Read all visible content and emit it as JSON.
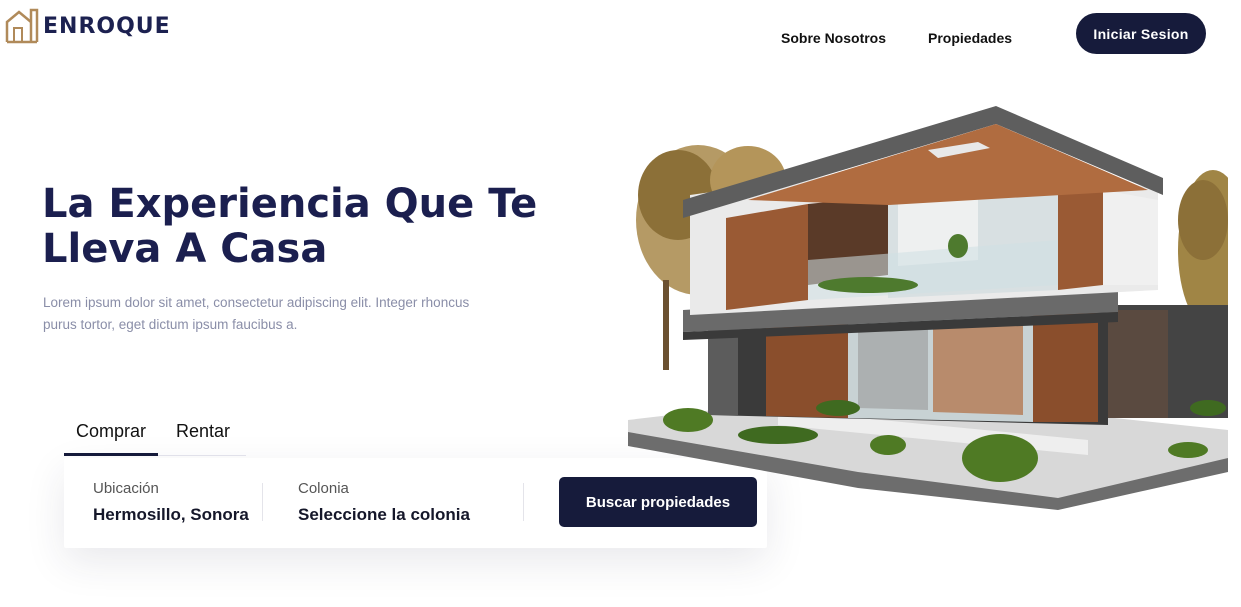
{
  "header": {
    "brand": "ENROQUE",
    "logo_icon": "house-outline-icon",
    "nav": {
      "about": "Sobre Nosotros",
      "properties": "Propiedades"
    },
    "login_label": "Iniciar Sesion"
  },
  "hero": {
    "title": "La Experiencia Que Te Lleva A Casa",
    "description": "Lorem ipsum dolor sit amet, consectetur adipiscing elit. Integer rhoncus purus tortor, eget dictum ipsum faucibus a."
  },
  "search": {
    "tabs": [
      {
        "label": "Comprar",
        "active": true
      },
      {
        "label": "Rentar",
        "active": false
      }
    ],
    "location": {
      "label": "Ubicación",
      "value": "Hermosillo, Sonora"
    },
    "neighborhood": {
      "label": "Colonia",
      "value": "Seleccione la colonia"
    },
    "button_label": "Buscar propiedades"
  },
  "colors": {
    "primary": "#161b3b",
    "title": "#1b1f4f",
    "muted_text": "#8a8ea8",
    "logo_gold": "#b08a5a"
  }
}
